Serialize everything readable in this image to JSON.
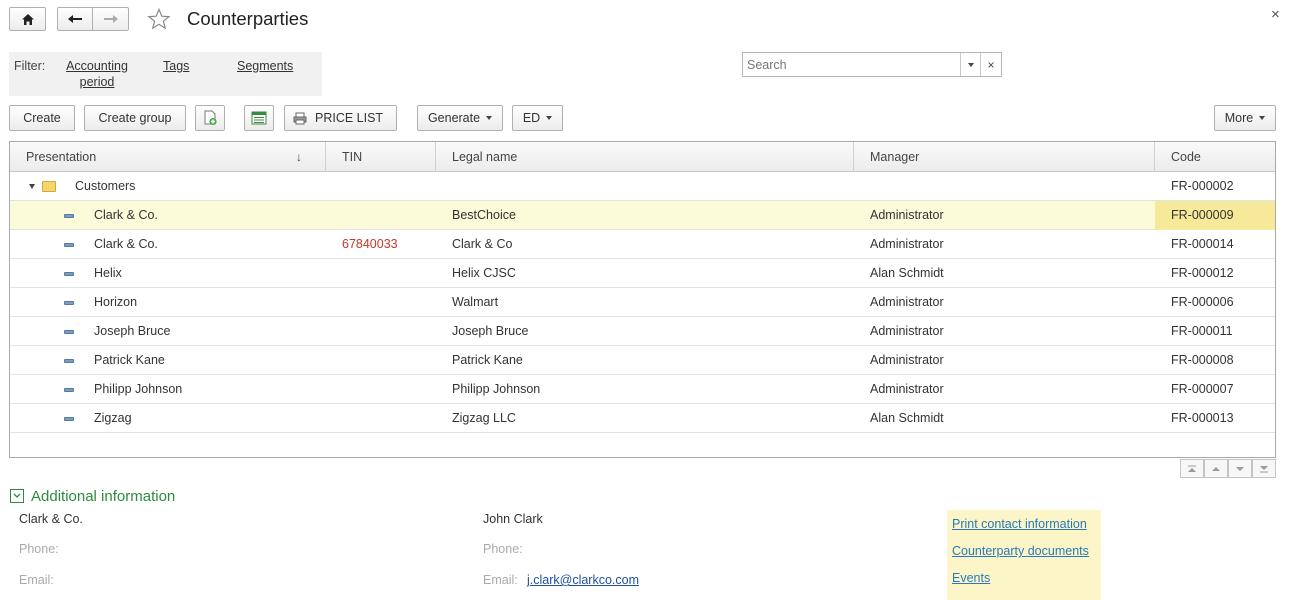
{
  "window": {
    "title": "Counterparties",
    "close_glyph": "×"
  },
  "filter": {
    "label": "Filter:",
    "links": [
      "Accounting period",
      "Tags",
      "Segments"
    ],
    "accounting_line1": "Accounting",
    "accounting_line2": "period"
  },
  "search": {
    "placeholder": "Search",
    "clear_glyph": "×"
  },
  "toolbar": {
    "create": "Create",
    "create_group": "Create group",
    "price_list": "PRICE LIST",
    "generate": "Generate",
    "ed": "ED",
    "more": "More"
  },
  "table": {
    "columns": [
      "Presentation",
      "TIN",
      "Legal name",
      "Manager",
      "Code"
    ],
    "sort_indicator": "↓",
    "group": {
      "name": "Customers",
      "code": "FR-000002"
    },
    "rows": [
      {
        "presentation": "Clark & Co.",
        "tin": "",
        "legal_name": "BestChoice",
        "manager": "Administrator",
        "code": "FR-000009"
      },
      {
        "presentation": "Clark & Co.",
        "tin": "67840033",
        "legal_name": "Clark & Co",
        "manager": "Administrator",
        "code": "FR-000014"
      },
      {
        "presentation": "Helix",
        "tin": "",
        "legal_name": "Helix CJSC",
        "manager": "Alan Schmidt",
        "code": "FR-000012"
      },
      {
        "presentation": "Horizon",
        "tin": "",
        "legal_name": "Walmart",
        "manager": "Administrator",
        "code": "FR-000006"
      },
      {
        "presentation": "Joseph Bruce",
        "tin": "",
        "legal_name": "Joseph Bruce",
        "manager": "Administrator",
        "code": "FR-000011"
      },
      {
        "presentation": "Patrick Kane",
        "tin": "",
        "legal_name": "Patrick Kane",
        "manager": "Administrator",
        "code": "FR-000008"
      },
      {
        "presentation": "Philipp Johnson",
        "tin": "",
        "legal_name": "Philipp Johnson",
        "manager": "Administrator",
        "code": "FR-000007"
      },
      {
        "presentation": "Zigzag",
        "tin": "",
        "legal_name": "Zigzag LLC",
        "manager": "Alan Schmidt",
        "code": "FR-000013"
      }
    ]
  },
  "additional": {
    "title": "Additional information",
    "company": "Clark & Co.",
    "contact": "John Clark",
    "phone_label": "Phone:",
    "email_label": "Email:",
    "contact_email": "j.clark@clarkco.com",
    "links": [
      "Print contact information",
      "Counterparty documents",
      "Events"
    ]
  },
  "colors": {
    "accent_green": "#2e8b3e",
    "selected_row": "#fbfad9",
    "selected_cell": "#f7e99a",
    "tin_red": "#c0392b",
    "link_blue": "#2a7ab8",
    "side_panel": "#fbf5c8"
  }
}
